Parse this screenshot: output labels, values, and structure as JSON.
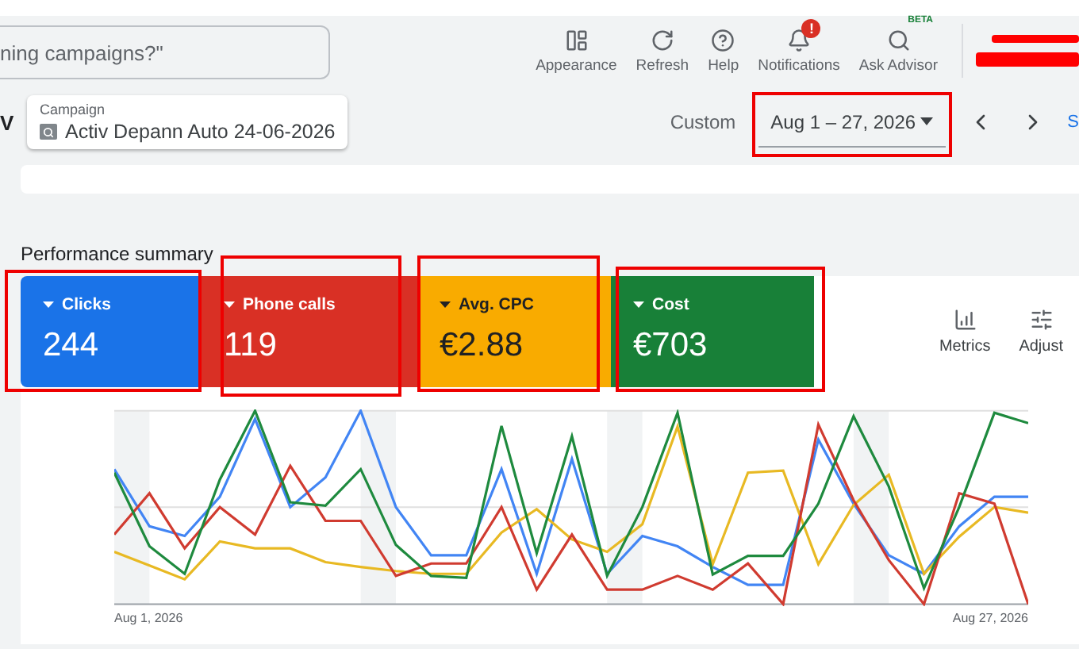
{
  "search": {
    "placeholder": "ning campaigns?\""
  },
  "toolbar": [
    {
      "kind": "appearance",
      "label": "Appearance"
    },
    {
      "kind": "refresh",
      "label": "Refresh"
    },
    {
      "kind": "help",
      "label": "Help"
    },
    {
      "kind": "notifications",
      "label": "Notifications",
      "badge": "!"
    },
    {
      "kind": "advisor",
      "label": "Ask Advisor",
      "tag": "BETA"
    }
  ],
  "left_cut_text": "V",
  "campaign": {
    "label": "Campaign",
    "value": "Activ Depann Auto 24-06-2026"
  },
  "date_range": {
    "preset": "Custom",
    "value": "Aug 1 – 27, 2026",
    "highlighted": true
  },
  "right_cut_text": "S",
  "summary": {
    "title": "Performance summary",
    "metrics": [
      {
        "label": "Clicks",
        "value": "244",
        "color": "#1a73e8",
        "highlighted": true
      },
      {
        "label": "Phone calls",
        "value": "119",
        "color": "#d93025",
        "highlighted": true
      },
      {
        "label": "Avg. CPC",
        "value": "€2.88",
        "color": "#f9ab00",
        "highlighted": true
      },
      {
        "label": "Cost",
        "value": "€703",
        "color": "#188038",
        "highlighted": true
      }
    ],
    "actions": [
      {
        "kind": "metrics",
        "label": "Metrics"
      },
      {
        "kind": "adjust",
        "label": "Adjust"
      }
    ],
    "x_start": "Aug 1, 2026",
    "x_end": "Aug 27, 2026"
  }
}
